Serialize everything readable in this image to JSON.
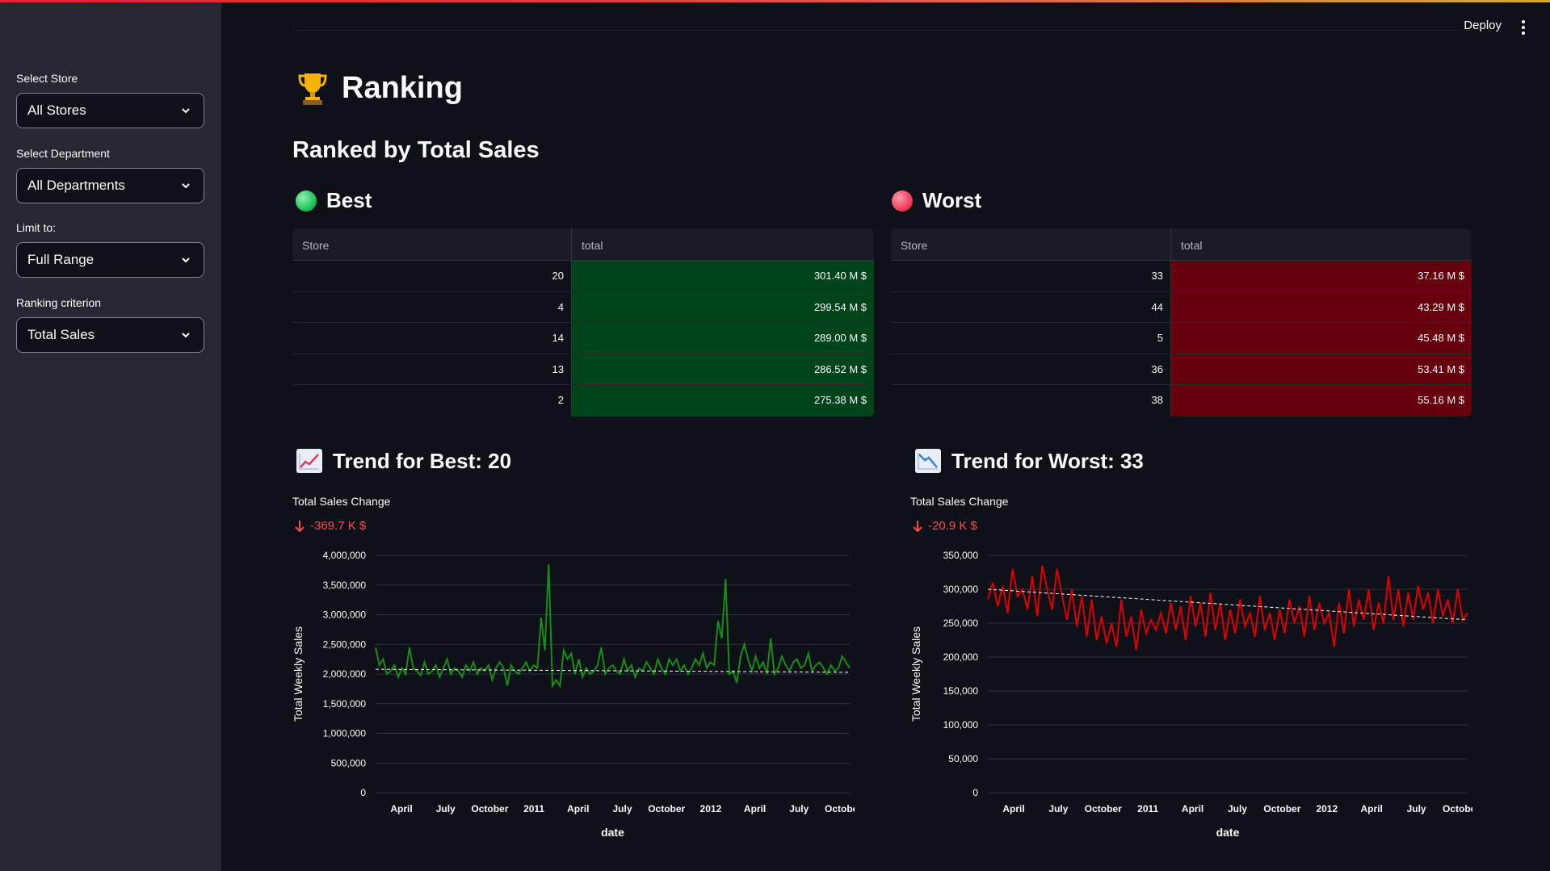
{
  "header": {
    "deploy_label": "Deploy"
  },
  "sidebar": {
    "filters": [
      {
        "label": "Select Store",
        "value": "All Stores"
      },
      {
        "label": "Select Department",
        "value": "All Departments"
      },
      {
        "label": "Limit to:",
        "value": "Full Range"
      },
      {
        "label": "Ranking criterion",
        "value": "Total Sales"
      }
    ]
  },
  "main": {
    "title": "Ranking",
    "title_icon": "trophy-icon",
    "subtitle": "Ranked by Total Sales",
    "best": {
      "heading": "Best",
      "color": "#3dd56d",
      "columns": [
        "Store",
        "total"
      ],
      "rows": [
        {
          "store": "20",
          "total": "301.40 M $"
        },
        {
          "store": "4",
          "total": "299.54 M $"
        },
        {
          "store": "14",
          "total": "289.00 M $"
        },
        {
          "store": "13",
          "total": "286.52 M $"
        },
        {
          "store": "2",
          "total": "275.38 M $"
        }
      ],
      "cell_color": "#00441b"
    },
    "worst": {
      "heading": "Worst",
      "color": "#ff4b4b",
      "columns": [
        "Store",
        "total"
      ],
      "rows": [
        {
          "store": "33",
          "total": "37.16 M $"
        },
        {
          "store": "44",
          "total": "43.29 M $"
        },
        {
          "store": "5",
          "total": "45.48 M $"
        },
        {
          "store": "36",
          "total": "53.41 M $"
        },
        {
          "store": "38",
          "total": "55.16 M $"
        }
      ],
      "cell_color": "#67000d"
    },
    "trend_best": {
      "heading": "Trend for Best: 20",
      "icon": "chart-increasing-icon",
      "metric_label": "Total Sales Change",
      "metric_value": "-369.7 K $"
    },
    "trend_worst": {
      "heading": "Trend for Worst: 33",
      "icon": "chart-decreasing-icon",
      "metric_label": "Total Sales Change",
      "metric_value": "-20.9 K $"
    }
  },
  "chart_data": [
    {
      "type": "line",
      "ylabel": "Total Weekly Sales",
      "xlabel": "date",
      "x_ticks": [
        "April",
        "July",
        "October",
        "2011",
        "April",
        "July",
        "October",
        "2012",
        "April",
        "July",
        "October"
      ],
      "y_ticks": [
        "0",
        "500,000",
        "1,000,000",
        "1,500,000",
        "2,000,000",
        "2,500,000",
        "3,000,000",
        "3,500,000",
        "4,000,000"
      ],
      "ylim": [
        0,
        4000000
      ],
      "series": [
        {
          "color": "#1a8c1a",
          "values": [
            2450000,
            2150000,
            2250000,
            2000000,
            2050000,
            2150000,
            1950000,
            2100000,
            2000000,
            2450000,
            2100000,
            2050000,
            1980000,
            2200000,
            2000000,
            2050000,
            2150000,
            1950000,
            2100000,
            2250000,
            2000000,
            2100000,
            2050000,
            1950000,
            2150000,
            2050000,
            2200000,
            2000000,
            2100000,
            2050000,
            2150000,
            1900000,
            2100000,
            2200000,
            2100000,
            1800000,
            2150000,
            2050000,
            2000000,
            2100000,
            2200000,
            2050000,
            2150000,
            2100000,
            2950000,
            2400000,
            3850000,
            1800000,
            1900000,
            1800000,
            2400000,
            2250000,
            2350000,
            2000000,
            2250000,
            1950000,
            2100000,
            2000000,
            2050000,
            2150000,
            2450000,
            2000000,
            2100000,
            2150000,
            2050000,
            2000000,
            2250000,
            2050000,
            2150000,
            1950000,
            2100000,
            2050000,
            2200000,
            2100000,
            2000000,
            2250000,
            2100000,
            2000000,
            2250000,
            2150000,
            2250000,
            2050000,
            2150000,
            2000000,
            2100000,
            2250000,
            2150000,
            2350000,
            2100000,
            2200000,
            2150000,
            2900000,
            2600000,
            3600000,
            2000000,
            2050000,
            1850000,
            2300000,
            2500000,
            2250000,
            2050000,
            2300000,
            2100000,
            2200000,
            2000000,
            2600000,
            2000000,
            2100000,
            2300000,
            2150000,
            2050000,
            2200000,
            2250000,
            2100000,
            2150000,
            2350000,
            2050000,
            2150000,
            2200000,
            2100000,
            2000000,
            2150000,
            2050000,
            2100000,
            2300000,
            2200000,
            2100000
          ],
          "trend_start": 2080000,
          "trend_end": 2030000
        }
      ]
    },
    {
      "type": "line",
      "ylabel": "Total Weekly Sales",
      "xlabel": "date",
      "x_ticks": [
        "April",
        "July",
        "October",
        "2011",
        "April",
        "July",
        "October",
        "2012",
        "April",
        "July",
        "October"
      ],
      "y_ticks": [
        "0",
        "50,000",
        "100,000",
        "150,000",
        "200,000",
        "250,000",
        "300,000",
        "350,000"
      ],
      "ylim": [
        0,
        350000
      ],
      "series": [
        {
          "color": "#e00000",
          "values": [
            285000,
            310000,
            275000,
            305000,
            265000,
            330000,
            290000,
            300000,
            270000,
            320000,
            260000,
            335000,
            300000,
            270000,
            330000,
            290000,
            255000,
            300000,
            245000,
            290000,
            230000,
            285000,
            225000,
            260000,
            220000,
            250000,
            215000,
            285000,
            230000,
            260000,
            210000,
            270000,
            235000,
            255000,
            240000,
            265000,
            235000,
            280000,
            240000,
            275000,
            225000,
            290000,
            245000,
            280000,
            230000,
            295000,
            240000,
            280000,
            225000,
            270000,
            235000,
            285000,
            245000,
            265000,
            230000,
            290000,
            240000,
            265000,
            225000,
            270000,
            235000,
            285000,
            250000,
            275000,
            230000,
            290000,
            240000,
            280000,
            250000,
            265000,
            215000,
            280000,
            235000,
            300000,
            245000,
            285000,
            255000,
            300000,
            240000,
            280000,
            250000,
            320000,
            255000,
            300000,
            245000,
            295000,
            255000,
            305000,
            270000,
            295000,
            250000,
            300000,
            260000,
            285000,
            250000,
            300000,
            255000,
            265000
          ],
          "trend_start": 300000,
          "trend_end": 255000
        }
      ]
    }
  ]
}
